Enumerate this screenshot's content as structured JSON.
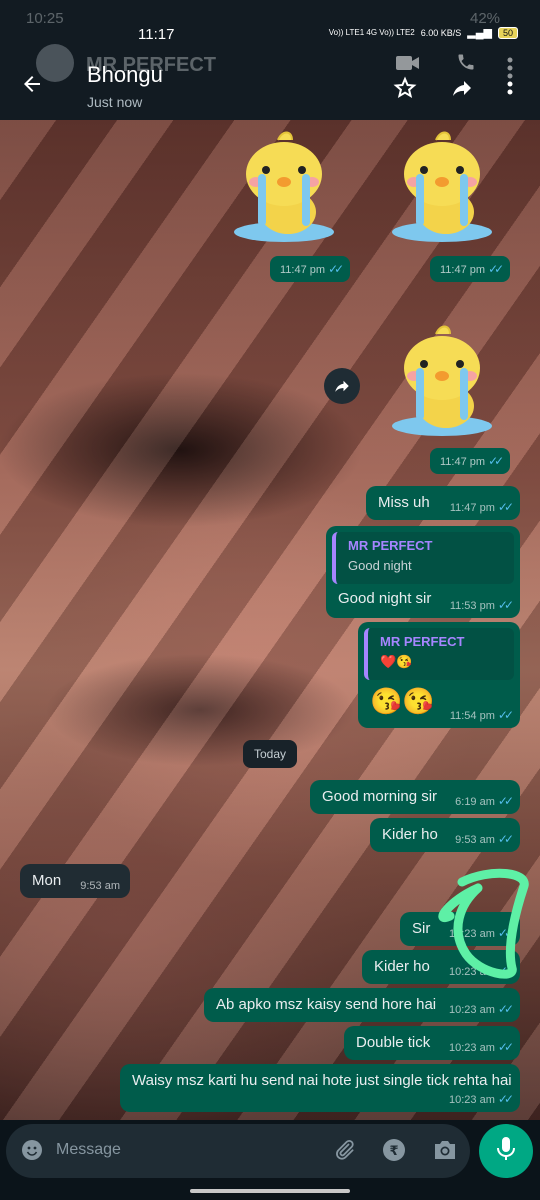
{
  "status": {
    "time_under": "10:25",
    "time": "11:17",
    "network": "Vo)) LTE1 4G Vo)) LTE2",
    "speed": "6.00 KB/S",
    "battery_under": "42%",
    "battery": "50"
  },
  "header": {
    "ghost_name": "MR PERFECT",
    "contact_name": "Bhongu",
    "subtitle": "Just now"
  },
  "date_divider": "Today",
  "messages": {
    "s1_time": "11:47 pm",
    "s2_time": "11:47 pm",
    "s3_time": "11:47 pm",
    "miss_text": "Miss uh",
    "miss_time": "11:47 pm",
    "q1_name": "MR PERFECT",
    "q1_text": "Good night",
    "gn_text": "Good night sir",
    "gn_time": "11:53 pm",
    "q2_name": "MR PERFECT",
    "q2_text": "❤️😘",
    "kiss_text": "😘😘",
    "kiss_time": "11:54 pm",
    "gm_text": "Good morning sir",
    "gm_time": "6:19 am",
    "kider1_text": "Kider ho",
    "kider1_time": "9:53 am",
    "mon_text": "Mon",
    "mon_time": "9:53 am",
    "sir_text": "Sir",
    "sir_time": "10:23 am",
    "kider2_text": "Kider ho",
    "kider2_time": "10:23 am",
    "apko_text": "Ab apko msz kaisy send hore hai",
    "apko_time": "10:23 am",
    "double_text": "Double tick",
    "double_time": "10:23 am",
    "waisy_text": "Waisy msz karti hu send nai hote just single tick rehta hai",
    "waisy_time": "10:23 am"
  },
  "composer": {
    "placeholder": "Message"
  },
  "colors": {
    "outgoing_bubble": "#005c4b",
    "incoming_bubble": "#202c33",
    "read_tick": "#53bdeb",
    "mic_button": "#00a884",
    "scribble": "#5ef0a6"
  }
}
